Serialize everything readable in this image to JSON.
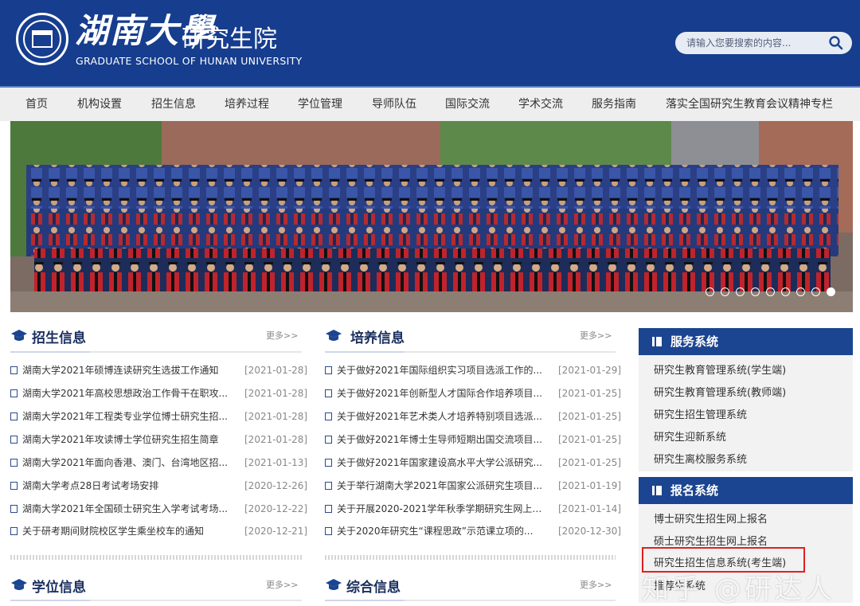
{
  "header": {
    "logo_calligraphy": "湖南大學",
    "logo_name": "研究生院",
    "logo_en": "GRADUATE SCHOOL OF HUNAN UNIVERSITY",
    "search_placeholder": "请输入您要搜索的内容...",
    "search_icon": "search-icon"
  },
  "nav": {
    "items": [
      {
        "label": "首页"
      },
      {
        "label": "机构设置"
      },
      {
        "label": "招生信息"
      },
      {
        "label": "培养过程"
      },
      {
        "label": "学位管理"
      },
      {
        "label": "导师队伍"
      },
      {
        "label": "国际交流"
      },
      {
        "label": "学术交流"
      },
      {
        "label": "服务指南"
      },
      {
        "label": "落实全国研究生教育会议精神专栏"
      }
    ]
  },
  "banner": {
    "dot_count": 9,
    "active_dot": 9
  },
  "admissions": {
    "title": "招生信息",
    "more": "更多>>",
    "items": [
      {
        "title": "湖南大学2021年硕博连读研究生选拔工作通知",
        "date": "[2021-01-28]"
      },
      {
        "title": "湖南大学2021年高校思想政治工作骨干在职攻...",
        "date": "[2021-01-28]"
      },
      {
        "title": "湖南大学2021年工程类专业学位博士研究生招...",
        "date": "[2021-01-28]"
      },
      {
        "title": "湖南大学2021年攻读博士学位研究生招生简章",
        "date": "[2021-01-28]"
      },
      {
        "title": "湖南大学2021年面向香港、澳门、台湾地区招...",
        "date": "[2021-01-13]"
      },
      {
        "title": "湖南大学考点28日考试考场安排",
        "date": "[2020-12-26]"
      },
      {
        "title": "湖南大学2021年全国硕士研究生入学考试考场...",
        "date": "[2020-12-22]"
      },
      {
        "title": "关于研考期间财院校区学生乘坐校车的通知",
        "date": "[2020-12-21]"
      }
    ]
  },
  "training": {
    "title": "培养信息",
    "more": "更多>>",
    "items": [
      {
        "title": "关于做好2021年国际组织实习项目选派工作的...",
        "date": "[2021-01-29]"
      },
      {
        "title": "关于做好2021年创新型人才国际合作培养项目...",
        "date": "[2021-01-25]"
      },
      {
        "title": "关于做好2021年艺术类人才培养特别项目选派...",
        "date": "[2021-01-25]"
      },
      {
        "title": "关于做好2021年博士生导师短期出国交流项目...",
        "date": "[2021-01-25]"
      },
      {
        "title": "关于做好2021年国家建设高水平大学公派研究...",
        "date": "[2021-01-25]"
      },
      {
        "title": "关于举行湖南大学2021年国家公派研究生项目...",
        "date": "[2021-01-19]"
      },
      {
        "title": "关于开展2020-2021学年秋季学期研究生网上评...",
        "date": "[2021-01-14]"
      },
      {
        "title": "关于2020年研究生“课程思政”示范课立项的...",
        "date": "[2020-12-30]"
      }
    ]
  },
  "degree": {
    "title": "学位信息",
    "more": "更多>>"
  },
  "general": {
    "title": "综合信息",
    "more": "更多>>"
  },
  "service": {
    "title": "服务系统",
    "items": [
      "研究生教育管理系统(学生端)",
      "研究生教育管理系统(教师端)",
      "研究生招生管理系统",
      "研究生迎新系统",
      "研究生离校服务系统"
    ]
  },
  "registration": {
    "title": "报名系统",
    "items": [
      "博士研究生招生网上报名",
      "硕士研究生招生网上报名",
      "研究生招生信息系统(考生端)",
      "推荐生系统"
    ]
  },
  "watermark": "知乎 @研达人",
  "colors": {
    "header_bg": "#163d8e",
    "panel_head_bg": "#1b4591",
    "highlight_border": "#e02020"
  }
}
